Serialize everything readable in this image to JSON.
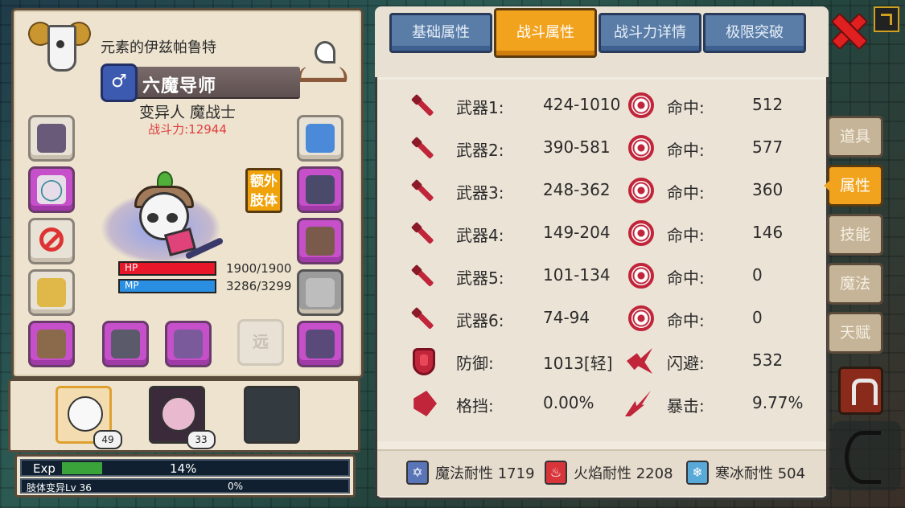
{
  "character": {
    "name": "元素的伊兹帕鲁特",
    "class_name": "六魔导师",
    "gender_symbol": "♂",
    "subclass": "变异人 魔战士",
    "combat_power": "战斗力:12944",
    "extra_body_button": "额外肢体",
    "ranged_slot_label": "远",
    "hp_label": "HP",
    "hp_value": "1900/1900",
    "mp_label": "MP",
    "mp_value": "3286/3299"
  },
  "companions": [
    {
      "level": "49"
    },
    {
      "level": "33"
    },
    {
      "level": ""
    }
  ],
  "exp": {
    "label": "Exp",
    "percent_text": "14%",
    "progress": 0.14,
    "body_label": "肢体变异Lv 36",
    "body_percent": "0%"
  },
  "tabs": [
    {
      "label": "基础属性",
      "active": false
    },
    {
      "label": "战斗属性",
      "active": true
    },
    {
      "label": "战斗力详情",
      "active": false
    },
    {
      "label": "极限突破",
      "active": false
    }
  ],
  "stats": [
    {
      "icon": "sword-icon",
      "label": "武器1:",
      "value": "424-1010",
      "icon2": "target-icon",
      "label2": "命中:",
      "value2": "512"
    },
    {
      "icon": "sword-icon",
      "label": "武器2:",
      "value": "390-581",
      "icon2": "target-icon",
      "label2": "命中:",
      "value2": "577"
    },
    {
      "icon": "sword-icon",
      "label": "武器3:",
      "value": "248-362",
      "icon2": "target-icon",
      "label2": "命中:",
      "value2": "360"
    },
    {
      "icon": "sword-icon",
      "label": "武器4:",
      "value": "149-204",
      "icon2": "target-icon",
      "label2": "命中:",
      "value2": "146"
    },
    {
      "icon": "sword-icon",
      "label": "武器5:",
      "value": "101-134",
      "icon2": "target-icon",
      "label2": "命中:",
      "value2": "0"
    },
    {
      "icon": "sword-icon",
      "label": "武器6:",
      "value": "74-94",
      "icon2": "target-icon",
      "label2": "命中:",
      "value2": "0"
    },
    {
      "icon": "shield-icon",
      "label": "防御:",
      "value": "1013[轻]",
      "icon2": "dodge-icon",
      "label2": "闪避:",
      "value2": "532"
    },
    {
      "icon": "block-icon",
      "label": "格挡:",
      "value": "0.00%",
      "icon2": "crit-icon",
      "label2": "暴击:",
      "value2": "9.77%"
    }
  ],
  "resistances": {
    "magic": "魔法耐性 1719",
    "fire": "火焰耐性 2208",
    "ice": "寒冰耐性 504"
  },
  "side_tabs": [
    {
      "label": "道具",
      "active": false
    },
    {
      "label": "属性",
      "active": true
    },
    {
      "label": "技能",
      "active": false
    },
    {
      "label": "魔法",
      "active": false
    },
    {
      "label": "天赋",
      "active": false
    }
  ],
  "colors": {
    "active_tab": "#f2a31e",
    "inactive_tab": "#5a7da8",
    "stat_icon_red": "#c0253a",
    "combat_power_red": "#e04040",
    "hp_red": "#e8182a",
    "mp_blue": "#2a8ee2"
  }
}
